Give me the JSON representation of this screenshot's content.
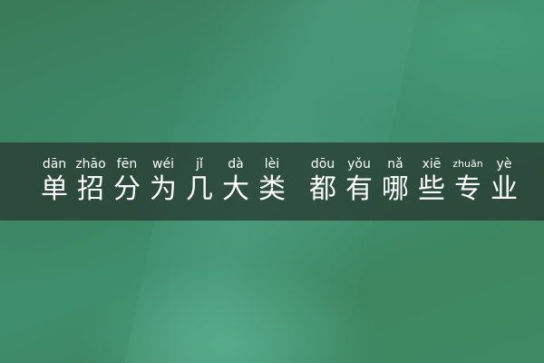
{
  "title": {
    "group1": [
      {
        "pinyin": "dān",
        "char": "单"
      },
      {
        "pinyin": "zhāo",
        "char": "招"
      },
      {
        "pinyin": "fēn",
        "char": "分"
      },
      {
        "pinyin": "wéi",
        "char": "为"
      },
      {
        "pinyin": "jǐ",
        "char": "几"
      },
      {
        "pinyin": "dà",
        "char": "大"
      },
      {
        "pinyin": "lèi",
        "char": "类"
      }
    ],
    "group2": [
      {
        "pinyin": "dōu",
        "char": "都"
      },
      {
        "pinyin": "yǒu",
        "char": "有"
      },
      {
        "pinyin": "nǎ",
        "char": "哪"
      },
      {
        "pinyin": "xiē",
        "char": "些"
      },
      {
        "pinyin": "zhuān",
        "char": "专"
      },
      {
        "pinyin": "yè",
        "char": "业"
      }
    ]
  },
  "colors": {
    "background": "#3d8864",
    "banner": "#283a32",
    "text": "#ffffff"
  }
}
